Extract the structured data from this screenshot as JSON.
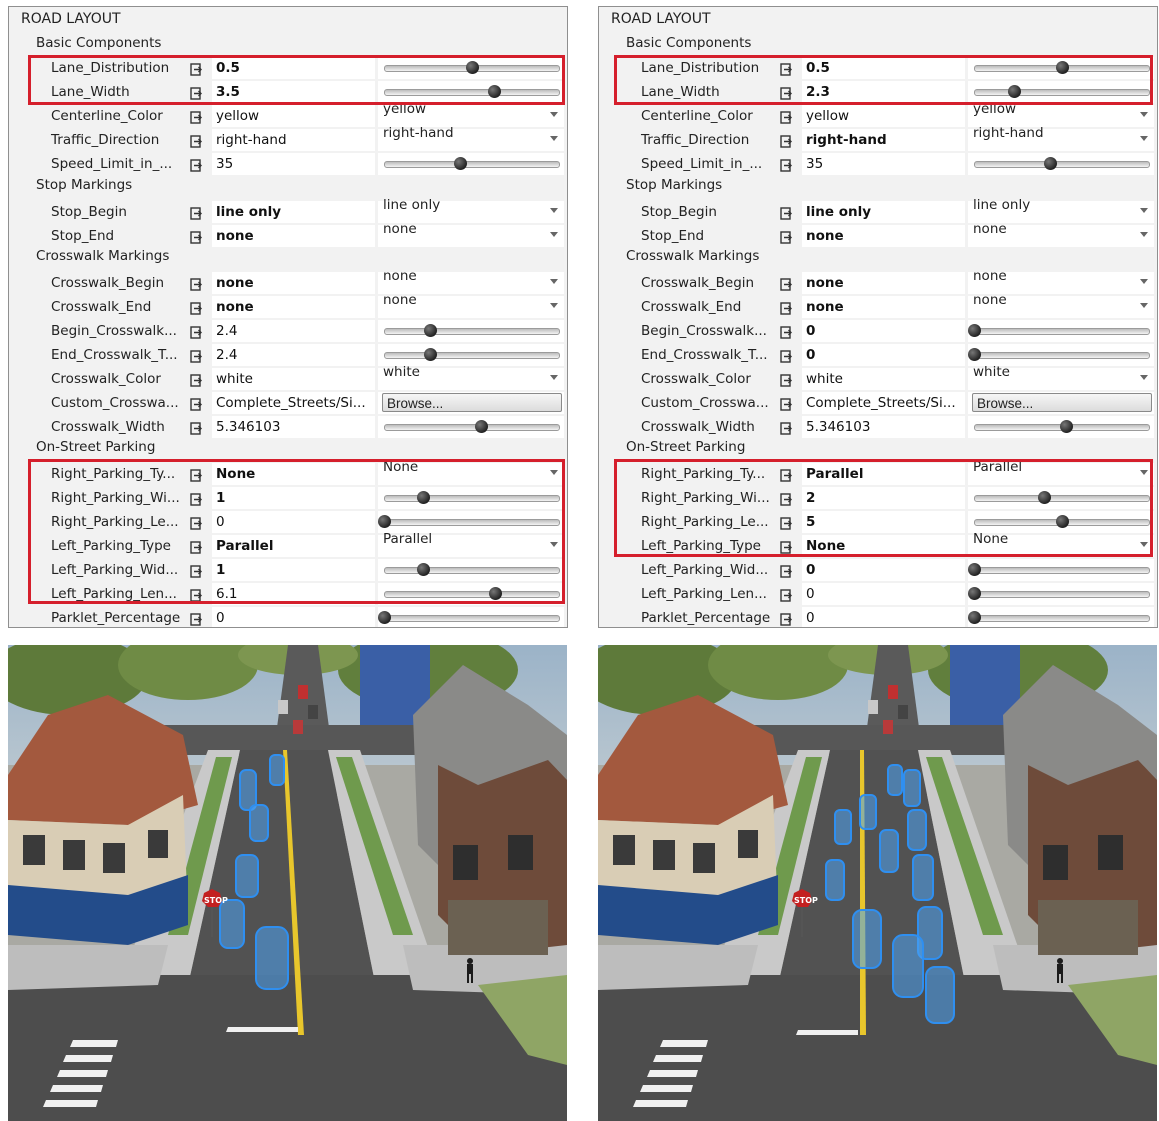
{
  "panels": [
    {
      "title": "ROAD LAYOUT",
      "groups": {
        "basic": "Basic Components",
        "stop": "Stop Markings",
        "crosswalk": "Crosswalk Markings",
        "parking": "On-Street Parking"
      },
      "rows": [
        {
          "label": "Lane_Distribution",
          "value": "0.5",
          "bold": true,
          "control": "slider",
          "level": 0.5
        },
        {
          "label": "Lane_Width",
          "value": "3.5",
          "bold": true,
          "control": "slider",
          "level": 0.625
        },
        {
          "label": "Centerline_Color",
          "value": "yellow",
          "bold": false,
          "control": "combo",
          "combo": "yellow"
        },
        {
          "label": "Traffic_Direction",
          "value": "right-hand",
          "bold": false,
          "control": "combo",
          "combo": "right-hand"
        },
        {
          "label": "Speed_Limit_in_...",
          "value": "35",
          "bold": false,
          "control": "slider",
          "level": 0.43
        },
        {
          "label": "Stop_Begin",
          "value": "line only",
          "bold": true,
          "control": "combo",
          "combo": "line only"
        },
        {
          "label": "Stop_End",
          "value": "none",
          "bold": true,
          "control": "combo",
          "combo": "none"
        },
        {
          "label": "Crosswalk_Begin",
          "value": "none",
          "bold": true,
          "control": "combo",
          "combo": "none"
        },
        {
          "label": "Crosswalk_End",
          "value": "none",
          "bold": true,
          "control": "combo",
          "combo": "none"
        },
        {
          "label": "Begin_Crosswalk...",
          "value": "2.4",
          "bold": false,
          "control": "slider",
          "level": 0.26
        },
        {
          "label": "End_Crosswalk_T...",
          "value": "2.4",
          "bold": false,
          "control": "slider",
          "level": 0.26
        },
        {
          "label": "Crosswalk_Color",
          "value": "white",
          "bold": false,
          "control": "combo",
          "combo": "white"
        },
        {
          "label": "Custom_Crosswa...",
          "value": "Complete_Streets/Si...",
          "bold": false,
          "control": "button",
          "button": "Browse..."
        },
        {
          "label": "Crosswalk_Width",
          "value": "5.346103",
          "bold": false,
          "control": "slider",
          "level": 0.55
        },
        {
          "label": "Right_Parking_Ty...",
          "value": "None",
          "bold": true,
          "control": "combo",
          "combo": "None"
        },
        {
          "label": "Right_Parking_Wi...",
          "value": "1",
          "bold": true,
          "control": "slider",
          "level": 0.22
        },
        {
          "label": "Right_Parking_Le...",
          "value": "0",
          "bold": false,
          "control": "slider",
          "level": 0.0
        },
        {
          "label": "Left_Parking_Type",
          "value": "Parallel",
          "bold": true,
          "control": "combo",
          "combo": "Parallel"
        },
        {
          "label": "Left_Parking_Wid...",
          "value": "1",
          "bold": true,
          "control": "slider",
          "level": 0.22
        },
        {
          "label": "Left_Parking_Len...",
          "value": "6.1",
          "bold": false,
          "control": "slider",
          "level": 0.63
        },
        {
          "label": "Parklet_Percentage",
          "value": "0",
          "bold": false,
          "control": "slider",
          "level": 0.0
        }
      ]
    },
    {
      "title": "ROAD LAYOUT",
      "groups": {
        "basic": "Basic Components",
        "stop": "Stop Markings",
        "crosswalk": "Crosswalk Markings",
        "parking": "On-Street Parking"
      },
      "rows": [
        {
          "label": "Lane_Distribution",
          "value": "0.5",
          "bold": true,
          "control": "slider",
          "level": 0.5
        },
        {
          "label": "Lane_Width",
          "value": "2.3",
          "bold": true,
          "control": "slider",
          "level": 0.23
        },
        {
          "label": "Centerline_Color",
          "value": "yellow",
          "bold": false,
          "control": "combo",
          "combo": "yellow"
        },
        {
          "label": "Traffic_Direction",
          "value": "right-hand",
          "bold": true,
          "control": "combo",
          "combo": "right-hand"
        },
        {
          "label": "Speed_Limit_in_...",
          "value": "35",
          "bold": false,
          "control": "slider",
          "level": 0.43
        },
        {
          "label": "Stop_Begin",
          "value": "line only",
          "bold": true,
          "control": "combo",
          "combo": "line only"
        },
        {
          "label": "Stop_End",
          "value": "none",
          "bold": true,
          "control": "combo",
          "combo": "none"
        },
        {
          "label": "Crosswalk_Begin",
          "value": "none",
          "bold": true,
          "control": "combo",
          "combo": "none"
        },
        {
          "label": "Crosswalk_End",
          "value": "none",
          "bold": true,
          "control": "combo",
          "combo": "none"
        },
        {
          "label": "Begin_Crosswalk...",
          "value": "0",
          "bold": true,
          "control": "slider",
          "level": 0.0
        },
        {
          "label": "End_Crosswalk_T...",
          "value": "0",
          "bold": true,
          "control": "slider",
          "level": 0.0
        },
        {
          "label": "Crosswalk_Color",
          "value": "white",
          "bold": false,
          "control": "combo",
          "combo": "white"
        },
        {
          "label": "Custom_Crosswa...",
          "value": "Complete_Streets/Si...",
          "bold": false,
          "control": "button",
          "button": "Browse..."
        },
        {
          "label": "Crosswalk_Width",
          "value": "5.346103",
          "bold": false,
          "control": "slider",
          "level": 0.52
        },
        {
          "label": "Right_Parking_Ty...",
          "value": "Parallel",
          "bold": true,
          "control": "combo",
          "combo": "Parallel"
        },
        {
          "label": "Right_Parking_Wi...",
          "value": "2",
          "bold": true,
          "control": "slider",
          "level": 0.4
        },
        {
          "label": "Right_Parking_Le...",
          "value": "5",
          "bold": true,
          "control": "slider",
          "level": 0.5
        },
        {
          "label": "Left_Parking_Type",
          "value": "None",
          "bold": true,
          "control": "combo",
          "combo": "None"
        },
        {
          "label": "Left_Parking_Wid...",
          "value": "0",
          "bold": true,
          "control": "slider",
          "level": 0.0
        },
        {
          "label": "Left_Parking_Len...",
          "value": "0",
          "bold": false,
          "control": "slider",
          "level": 0.0
        },
        {
          "label": "Parklet_Percentage",
          "value": "0",
          "bold": false,
          "control": "slider",
          "level": 0.0
        }
      ]
    }
  ],
  "scene": {
    "stop_sign": "STOP",
    "colors": {
      "highlight": "#d51f2c",
      "road": "#525252",
      "grass": "#6f9a4d",
      "sidewalk": "#c9c9c9",
      "vehicle_outline": "#2f8ff0",
      "centerline": "#e8c62c",
      "house_brick": "#a3593e",
      "house_blue": "#234c8a",
      "roof_gray": "#8a8a88"
    },
    "icons": [
      "stop-sign-icon",
      "pedestrian-icon",
      "link-icon"
    ]
  }
}
